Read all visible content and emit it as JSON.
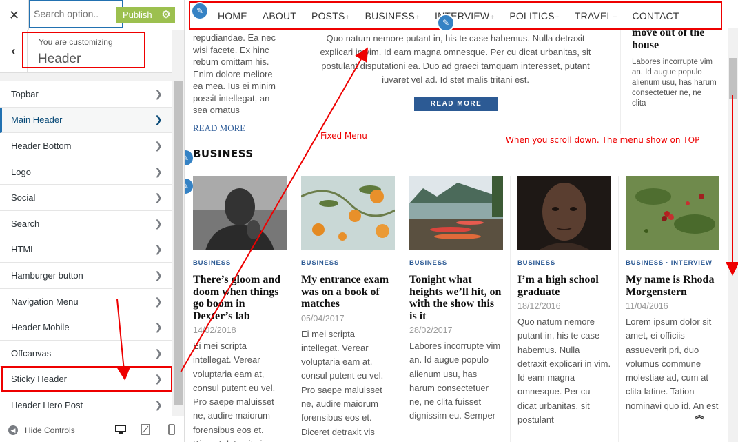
{
  "customizer": {
    "close_icon": "close-icon",
    "search_placeholder": "Search option..",
    "publish_label": "Publish",
    "settings_icon": "gear-icon",
    "back_icon": "chevron-left-icon",
    "customizing_label": "You are customizing",
    "section_title": "Header",
    "menu_items": [
      {
        "label": "Topbar"
      },
      {
        "label": "Main Header"
      },
      {
        "label": "Header Bottom"
      },
      {
        "label": "Logo"
      },
      {
        "label": "Social"
      },
      {
        "label": "Search"
      },
      {
        "label": "HTML"
      },
      {
        "label": "Hamburger button"
      },
      {
        "label": "Navigation Menu"
      },
      {
        "label": "Header Mobile"
      },
      {
        "label": "Offcanvas"
      },
      {
        "label": "Sticky Header"
      },
      {
        "label": "Header Hero Post"
      }
    ],
    "active_item": "Main Header",
    "hide_controls_label": "Hide Controls",
    "device_icons": [
      "desktop-icon",
      "tablet-icon",
      "mobile-icon"
    ],
    "accent_color": "#9cc04f"
  },
  "preview": {
    "nav": [
      "HOME",
      "ABOUT",
      "POSTS",
      "BUSINESS",
      "INTERVIEW",
      "POLITICS",
      "TRAVEL",
      "CONTACT"
    ],
    "nav_plus": "+",
    "left_col_text": [
      "repudiandae. Ea nec",
      "wisi facete. Ex hinc",
      "rebum omittam his.",
      "Enim dolore meliore",
      "ea mea. Ius ei minim",
      "possit intellegat, an",
      "sea ornatus"
    ],
    "read_more_link": "READ MORE",
    "center_text": [
      "Quo natum nemore putant in, his te case habemus. Nulla detraxit",
      "explicari in vim. Id eam magna omnesque. Per cu dicat urbanitas, sit",
      "postulant disputationi ea. Duo ad graeci tamquam interesset, putant",
      "iuvaret vel ad. Id stet malis tritani est."
    ],
    "read_more_button": "READ MORE",
    "right_title": [
      "move out of the",
      "house"
    ],
    "right_text": [
      "Labores incorrupte vim",
      "an. Id augue populo",
      "alienum usu, has harum",
      "consectetuer ne, ne",
      "clita"
    ],
    "section_title": "BUSINESS",
    "cards": [
      {
        "cat": "BUSINESS",
        "title": "There’s gloom and doom when things go boom in Dexter’s lab",
        "date": "14/02/2018",
        "excerpt": "Ei mei scripta intellegat. Verear voluptaria eam at, consul putent eu vel. Pro saepe maluisset ne, audire maiorum forensibus eos et. Diceret detraxit vis"
      },
      {
        "cat": "BUSINESS",
        "title": "My entrance exam was on a book of matches",
        "date": "05/04/2017",
        "excerpt": "Ei mei scripta intellegat. Verear voluptaria eam at, consul putent eu vel. Pro saepe maluisset ne, audire maiorum forensibus eos et. Diceret detraxit vis"
      },
      {
        "cat": "BUSINESS",
        "title": "Tonight what heights we’ll hit, on with the show this is it",
        "date": "28/02/2017",
        "excerpt": "Labores incorrupte vim an. Id augue populo alienum usu, has harum consectetuer ne, ne clita fuisset dignissim eu. Semper"
      },
      {
        "cat": "BUSINESS",
        "title": "I’m a high school graduate",
        "date": "18/12/2016",
        "excerpt": "Quo natum nemore putant in, his te case habemus. Nulla detraxit explicari in vim. Id eam magna omnesque. Per cu dicat urbanitas, sit postulant"
      },
      {
        "cat": "BUSINESS · INTERVIEW",
        "title": "My name is Rhoda Morgenstern",
        "date": "11/04/2016",
        "excerpt": "Lorem ipsum dolor sit amet, ei officiis assueverit pri, duo volumus commune molestiae ad, cum at clita latine. Tation nominavi quo id. An est"
      }
    ],
    "annotation_fixed": "Fixed Menu",
    "annotation_scroll": "When you scroll down. The menu show on TOP",
    "back_to_top_icon": "double-chevron-up-icon",
    "link_color": "#2c5a94",
    "annotation_color": "#ee0000"
  }
}
